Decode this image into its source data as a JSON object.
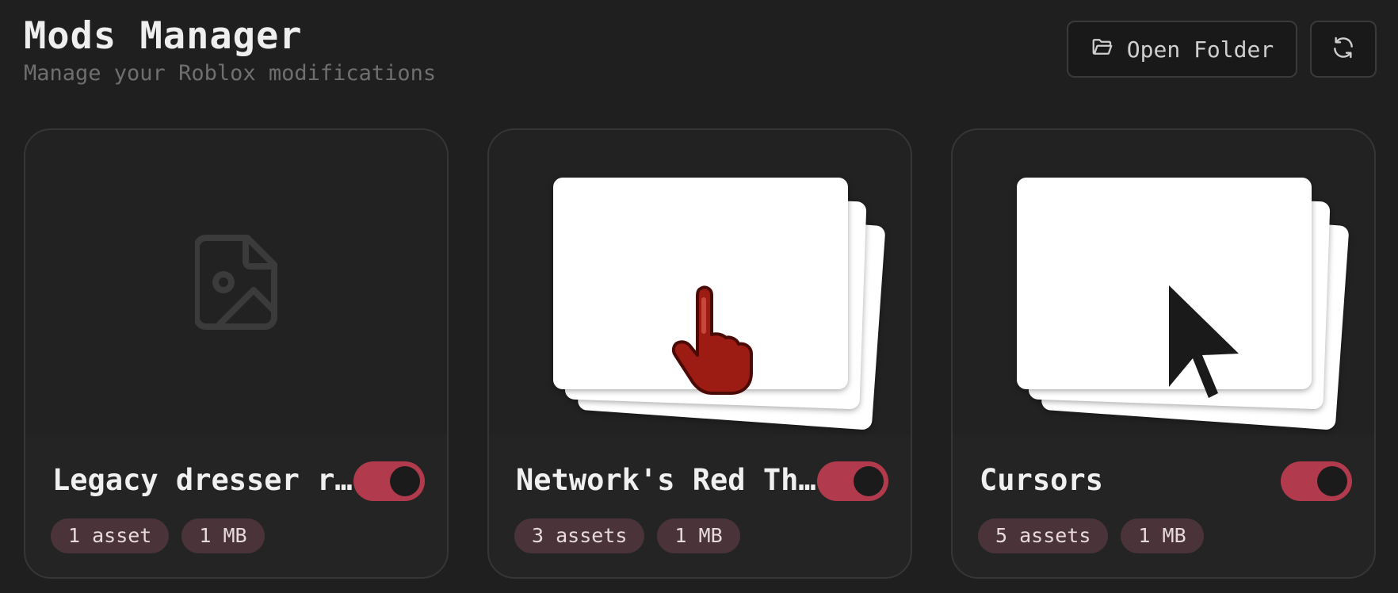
{
  "header": {
    "title": "Mods Manager",
    "subtitle": "Manage your Roblox modifications"
  },
  "toolbar": {
    "open_folder_label": "Open Folder",
    "open_folder_icon": "folder-open-icon",
    "refresh_icon": "refresh-icon"
  },
  "colors": {
    "accent": "#b23a4d",
    "badge_bg": "#4a3439",
    "background": "#1f1f1f"
  },
  "mods": [
    {
      "name": "Legacy dresser r…",
      "enabled": true,
      "assets_label": "1 asset",
      "size_label": "1 MB",
      "preview": "image-placeholder-icon"
    },
    {
      "name": "Network's Red Th…",
      "enabled": true,
      "assets_label": "3 assets",
      "size_label": "1 MB",
      "preview": "red-hand-cursor"
    },
    {
      "name": "Cursors",
      "enabled": true,
      "assets_label": "5 assets",
      "size_label": "1 MB",
      "preview": "arrow-cursor"
    }
  ]
}
